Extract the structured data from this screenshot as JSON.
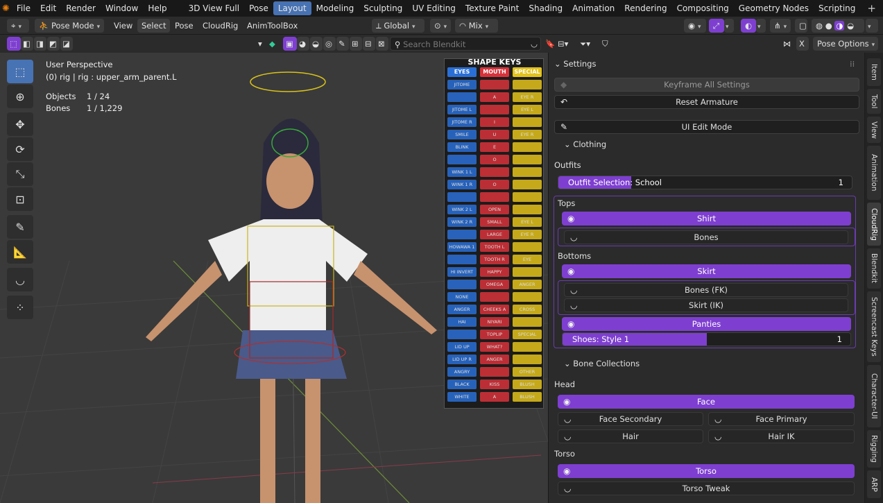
{
  "menubar": {
    "items": [
      "File",
      "Edit",
      "Render",
      "Window",
      "Help"
    ],
    "workspaces": [
      "3D View Full",
      "Pose",
      "Layout",
      "Modeling",
      "Sculpting",
      "UV Editing",
      "Texture Paint",
      "Shading",
      "Animation",
      "Rendering",
      "Compositing",
      "Geometry Nodes",
      "Scripting"
    ],
    "active_workspace": "Layout",
    "add_label": "+"
  },
  "header": {
    "mode": "Pose Mode",
    "menus": [
      "View",
      "Select",
      "Pose",
      "CloudRig",
      "AnimToolBox"
    ],
    "orientation": "Global",
    "blend": "Mix",
    "search_placeholder": "Search Blendkit",
    "pose_options": "Pose Options",
    "close_label": "X"
  },
  "viewport": {
    "perspective": "User Perspective",
    "object_line": "(0) rig | rig : upper_arm_parent.L",
    "objects_label": "Objects",
    "objects_value": "1 / 24",
    "bones_label": "Bones",
    "bones_value": "1 / 1,229"
  },
  "shape_keys": {
    "title": "SHAPE KEYS",
    "columns": [
      {
        "name": "EYES",
        "color": "#2a6fd6",
        "items": [
          "JITOME",
          "",
          "JITOME L",
          "JITOME R",
          "SMILE",
          "BLINK",
          "",
          "WINK 1 L",
          "WINK 1 R",
          "",
          "WINK 2 L",
          "WINK 2 R",
          "",
          "HOWAWA 1",
          "",
          "HI INVERT",
          "",
          "NONE",
          "ANGER",
          "HAI",
          "",
          "LID UP",
          "LID UP R",
          "ANGRY",
          "BLACK",
          "WHITE"
        ]
      },
      {
        "name": "MOUTH",
        "color": "#d8323a",
        "items": [
          "",
          "A",
          "",
          "I",
          "U",
          "E",
          "O",
          "",
          "O",
          "",
          "OPEN",
          "SMALL",
          "LARGE",
          "TOOTH L",
          "TOOTH R",
          "HAPPY",
          "OMEGA",
          "",
          "CHEEKS A",
          "NIYARI",
          "TOPLIP",
          "WHAT?",
          "ANGER",
          "",
          "KISS",
          "A"
        ]
      },
      {
        "name": "SPECIAL",
        "color": "#e3c21a",
        "items": [
          "",
          "EYE R",
          "EYE L",
          "",
          "EYE R",
          "",
          "",
          "",
          "",
          "",
          "",
          "EYE L",
          "EYE R",
          "",
          "EYE",
          "",
          "ANGER",
          "",
          "CROSS",
          "",
          "SPECIAL",
          "",
          "",
          "OTHER",
          "BLUSH",
          "BLUSH"
        ]
      }
    ],
    "other_label": "OTHER"
  },
  "sidebar": {
    "settings_label": "Settings",
    "keyframe_all": "Keyframe All Settings",
    "reset_armature": "Reset Armature",
    "ui_edit_mode": "UI Edit Mode",
    "clothing_label": "Clothing",
    "outfits_label": "Outfits",
    "outfit_selection_label": "Outfit Selection:",
    "outfit_selection_value": "School",
    "outfit_selection_index": "1",
    "tops_label": "Tops",
    "shirt": "Shirt",
    "tops_bones": "Bones",
    "bottoms_label": "Bottoms",
    "skirt": "Skirt",
    "bones_fk": "Bones (FK)",
    "skirt_ik": "Skirt (IK)",
    "panties": "Panties",
    "shoes_label": "Shoes: Style 1",
    "shoes_value": "1",
    "shoes_fill": 0.5,
    "bone_collections_label": "Bone Collections",
    "head_label": "Head",
    "face": "Face",
    "face_secondary": "Face Secondary",
    "face_primary": "Face Primary",
    "hair": "Hair",
    "hair_ik": "Hair IK",
    "torso_label": "Torso",
    "torso": "Torso",
    "torso_tweak": "Torso Tweak"
  },
  "tabs": [
    "Item",
    "Tool",
    "View",
    "Animation",
    "CloudRig",
    "Blendkit",
    "Screencast Keys",
    "Character-UI",
    "Rigging",
    "ARP"
  ],
  "active_tab": "CloudRig",
  "colors": {
    "accent": "#7e3fd0",
    "active_blue": "#4772b3",
    "background": "#2b2b2b"
  }
}
